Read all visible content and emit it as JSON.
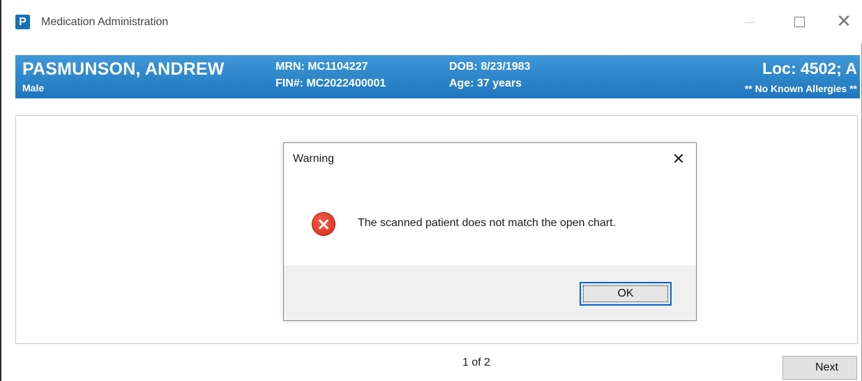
{
  "window": {
    "title": "Medication Administration",
    "app_icon_letter": "P",
    "icons": [
      "app-icon",
      "minimize-icon",
      "maximize-icon",
      "close-icon"
    ]
  },
  "banner": {
    "name": "PASMUNSON, ANDREW",
    "sex": "Male",
    "mrn": "MRN: MC1104227",
    "fin": "FIN#: MC2022400001",
    "dob": "DOB: 8/23/1983",
    "age": "Age: 37 years",
    "location": "Loc: 4502; A",
    "allergies": "** No Known Allergies **",
    "color": "#2a84c8"
  },
  "dialog": {
    "title": "Warning",
    "close_glyph": "✕",
    "message": "The scanned patient does not match the open chart.",
    "ok_label": "OK",
    "icon": "error-icon",
    "icon_color": "#e0301e"
  },
  "footer": {
    "pager": "1 of 2",
    "next_label": "Next"
  }
}
